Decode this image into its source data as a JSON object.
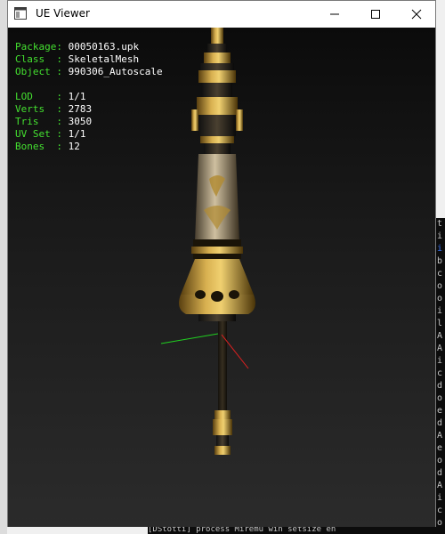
{
  "window": {
    "title": "UE Viewer"
  },
  "info": {
    "rows": [
      {
        "key": "Package",
        "sep": ": ",
        "value": "00050163.upk"
      },
      {
        "key": "Class  ",
        "sep": ": ",
        "value": "SkeletalMesh"
      },
      {
        "key": "Object ",
        "sep": ": ",
        "value": "990306_Autoscale"
      }
    ],
    "stats": [
      {
        "key": "LOD    ",
        "sep": ": ",
        "value": "1/1"
      },
      {
        "key": "Verts  ",
        "sep": ": ",
        "value": "2783"
      },
      {
        "key": "Tris   ",
        "sep": ": ",
        "value": "3050"
      },
      {
        "key": "UV Set ",
        "sep": ": ",
        "value": "1/1"
      },
      {
        "key": "Bones  ",
        "sep": ": ",
        "value": "12"
      }
    ]
  },
  "console": {
    "bottom_line": "[DStotti] process  Miremu win setsize  en"
  },
  "colors": {
    "label": "#44e030",
    "value": "#ffffff",
    "gold": "#c8a040",
    "axis_x": "#e02020",
    "axis_y": "#20d020"
  }
}
